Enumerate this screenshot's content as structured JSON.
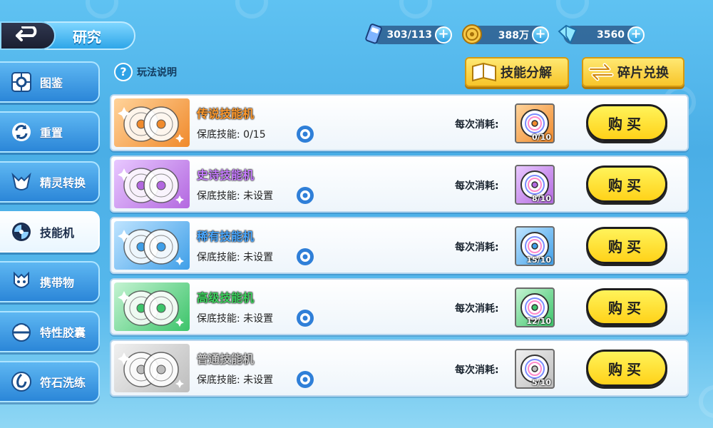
{
  "header": {
    "title": "研究"
  },
  "resources": [
    {
      "icon": "ticket-icon",
      "value": "303/113"
    },
    {
      "icon": "coin-icon",
      "value": "388万"
    },
    {
      "icon": "crystal-icon",
      "value": "3560"
    }
  ],
  "help": {
    "label": "玩法说明",
    "icon_text": "?"
  },
  "actions": {
    "decompose_label": "技能分解",
    "exchange_label": "碎片兑换"
  },
  "sidebar": {
    "items": [
      {
        "label": "图鉴",
        "icon": "pokedex-icon",
        "active": false
      },
      {
        "label": "重置",
        "icon": "reset-icon",
        "active": false
      },
      {
        "label": "精灵转换",
        "icon": "sprite-convert-icon",
        "active": false
      },
      {
        "label": "技能机",
        "icon": "disc-icon",
        "active": true
      },
      {
        "label": "携带物",
        "icon": "item-icon",
        "active": false
      },
      {
        "label": "特性胶囊",
        "icon": "capsule-icon",
        "active": false
      },
      {
        "label": "符石洗练",
        "icon": "rune-icon",
        "active": false
      }
    ]
  },
  "cost_label": "每次消耗:",
  "buy_label": "购买",
  "rows": [
    {
      "name": "传说技能机",
      "guarantee": "保底技能: 0/15",
      "count": "0/10",
      "color": "#f08a2c",
      "light": "#ffd39a",
      "name_color": "#ff9a2e"
    },
    {
      "name": "史诗技能机",
      "guarantee": "保底技能: 未设置",
      "count": "8/10",
      "color": "#b368e0",
      "light": "#e8c8ff",
      "name_color": "#c77dff"
    },
    {
      "name": "稀有技能机",
      "guarantee": "保底技能: 未设置",
      "count": "15/10",
      "color": "#3f9fe8",
      "light": "#bfe4ff",
      "name_color": "#4aa8ff"
    },
    {
      "name": "高级技能机",
      "guarantee": "保底技能: 未设置",
      "count": "12/10",
      "color": "#3cc46a",
      "light": "#c4f3d2",
      "name_color": "#3ed35f"
    },
    {
      "name": "普通技能机",
      "guarantee": "保底技能: 未设置",
      "count": "5/10",
      "color": "#bdbdbd",
      "light": "#f0f0f0",
      "name_color": "#c9c9c9"
    }
  ]
}
